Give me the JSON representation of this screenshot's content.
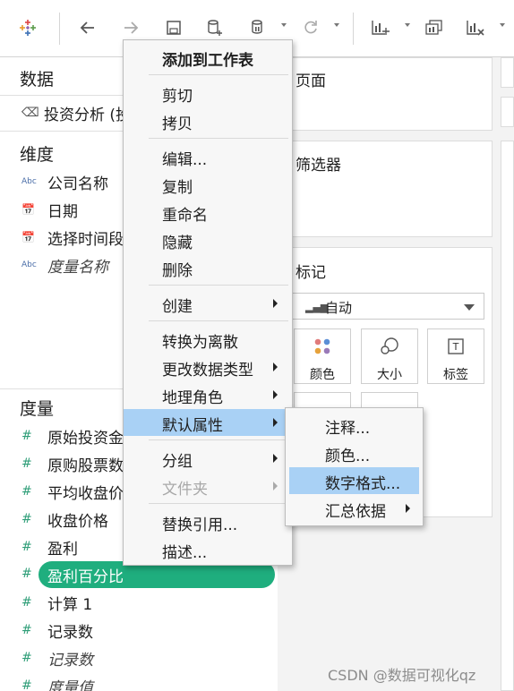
{
  "colors": {
    "accent_pill": "#1fae7e",
    "menu_highlight": "#a9d1f5",
    "measure_icon": "#2f9e78"
  },
  "toolbar": {
    "icons": [
      "tableau-logo-icon",
      "back-icon",
      "forward-icon",
      "save-icon",
      "new-datasource-icon",
      "pause-icon",
      "refresh-icon",
      "bar-chart-add-icon",
      "duplicate-sheet-icon",
      "clear-sheet-icon"
    ]
  },
  "data_pane": {
    "title": "数据",
    "datasource": "投资分析 (投",
    "dimensions_title": "维度",
    "dimensions": [
      {
        "type": "Abc",
        "label": "公司名称",
        "italic": false
      },
      {
        "type": "date",
        "label": "日期",
        "italic": false
      },
      {
        "type": "param-date",
        "label": "选择时间段",
        "italic": false
      },
      {
        "type": "Abc",
        "label": "度量名称",
        "italic": true
      }
    ],
    "measures_title": "度量",
    "measures": [
      {
        "label": "原始投资金",
        "italic": false
      },
      {
        "label": "原购股票数",
        "italic": false
      },
      {
        "label": "平均收盘价",
        "italic": false
      },
      {
        "label": "收盘价格",
        "italic": false
      },
      {
        "label": "盈利",
        "italic": false
      },
      {
        "label": "盈利百分比",
        "italic": false,
        "selected": true
      },
      {
        "label": "计算 1",
        "italic": false
      },
      {
        "label": "记录数",
        "italic": false
      },
      {
        "label": "记录数",
        "italic": true
      },
      {
        "label": "度量值",
        "italic": true
      }
    ]
  },
  "right": {
    "pages_title": "页面",
    "filters_title": "筛选器",
    "marks_title": "标记",
    "marks_type": "自动",
    "mark_buttons": [
      "颜色",
      "大小",
      "标签"
    ]
  },
  "context_menu": {
    "items": [
      {
        "label": "添加到工作表",
        "bold": true
      },
      {
        "label": "剪切"
      },
      {
        "label": "拷贝"
      },
      {
        "label": "编辑..."
      },
      {
        "label": "复制"
      },
      {
        "label": "重命名"
      },
      {
        "label": "隐藏"
      },
      {
        "label": "删除"
      },
      {
        "label": "创建",
        "submenu": true
      },
      {
        "label": "转换为离散"
      },
      {
        "label": "更改数据类型",
        "submenu": true
      },
      {
        "label": "地理角色",
        "submenu": true
      },
      {
        "label": "默认属性",
        "submenu": true,
        "highlighted": true
      },
      {
        "label": "分组",
        "submenu": true
      },
      {
        "label": "文件夹",
        "submenu": true,
        "disabled": true
      },
      {
        "label": "替换引用..."
      },
      {
        "label": "描述..."
      }
    ]
  },
  "submenu": {
    "items": [
      {
        "label": "注释..."
      },
      {
        "label": "颜色..."
      },
      {
        "label": "数字格式...",
        "highlighted": true
      },
      {
        "label": "汇总依据",
        "submenu": true
      }
    ]
  },
  "watermark": "CSDN @数据可视化qz"
}
